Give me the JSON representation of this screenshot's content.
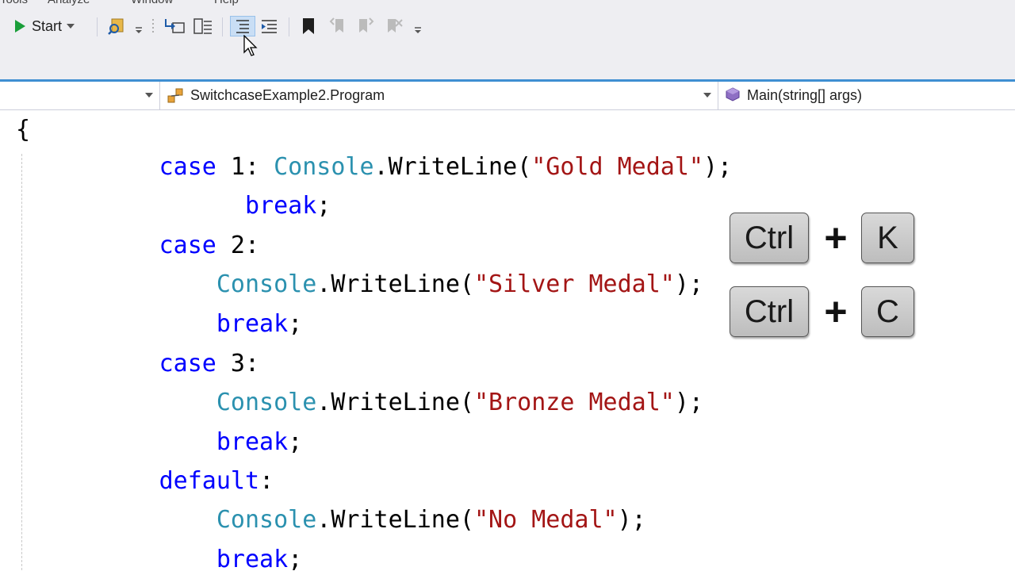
{
  "menu": {
    "items": [
      "Tools",
      "Analyze",
      "Window",
      "Help"
    ]
  },
  "toolbar": {
    "start_label": "Start"
  },
  "navbar": {
    "project": "",
    "class": "SwitchcaseExample2.Program",
    "member": "Main(string[] args)"
  },
  "code": {
    "brace": "{",
    "case1_kw": "case",
    "case1_val": " 1: ",
    "case1_cls": "Console",
    "case1_call": ".WriteLine(",
    "case1_str": "\"Gold Medal\"",
    "case1_end": ");",
    "break1": "break",
    "semi": ";",
    "case2_kw": "case",
    "case2_val": " 2:",
    "case2_cls": "Console",
    "case2_call": ".WriteLine(",
    "case2_str": "\"Silver Medal\"",
    "case2_end": ");",
    "break2": "break",
    "case3_kw": "case",
    "case3_val": " 3:",
    "case3_cls": "Console",
    "case3_call": ".WriteLine(",
    "case3_str": "\"Bronze Medal\"",
    "case3_end": ");",
    "break3": "break",
    "default_kw": "default",
    "default_colon": ":",
    "def_cls": "Console",
    "def_call": ".WriteLine(",
    "def_str": "\"No Medal\"",
    "def_end": ");",
    "break4": "break"
  },
  "shortcut": {
    "row1": {
      "key1": "Ctrl",
      "plus": "+",
      "key2": "K"
    },
    "row2": {
      "key1": "Ctrl",
      "plus": "+",
      "key2": "C"
    }
  },
  "colors": {
    "keyword": "#0000ff",
    "class": "#2b91af",
    "string": "#a31515",
    "accent": "#3f8fd2"
  }
}
